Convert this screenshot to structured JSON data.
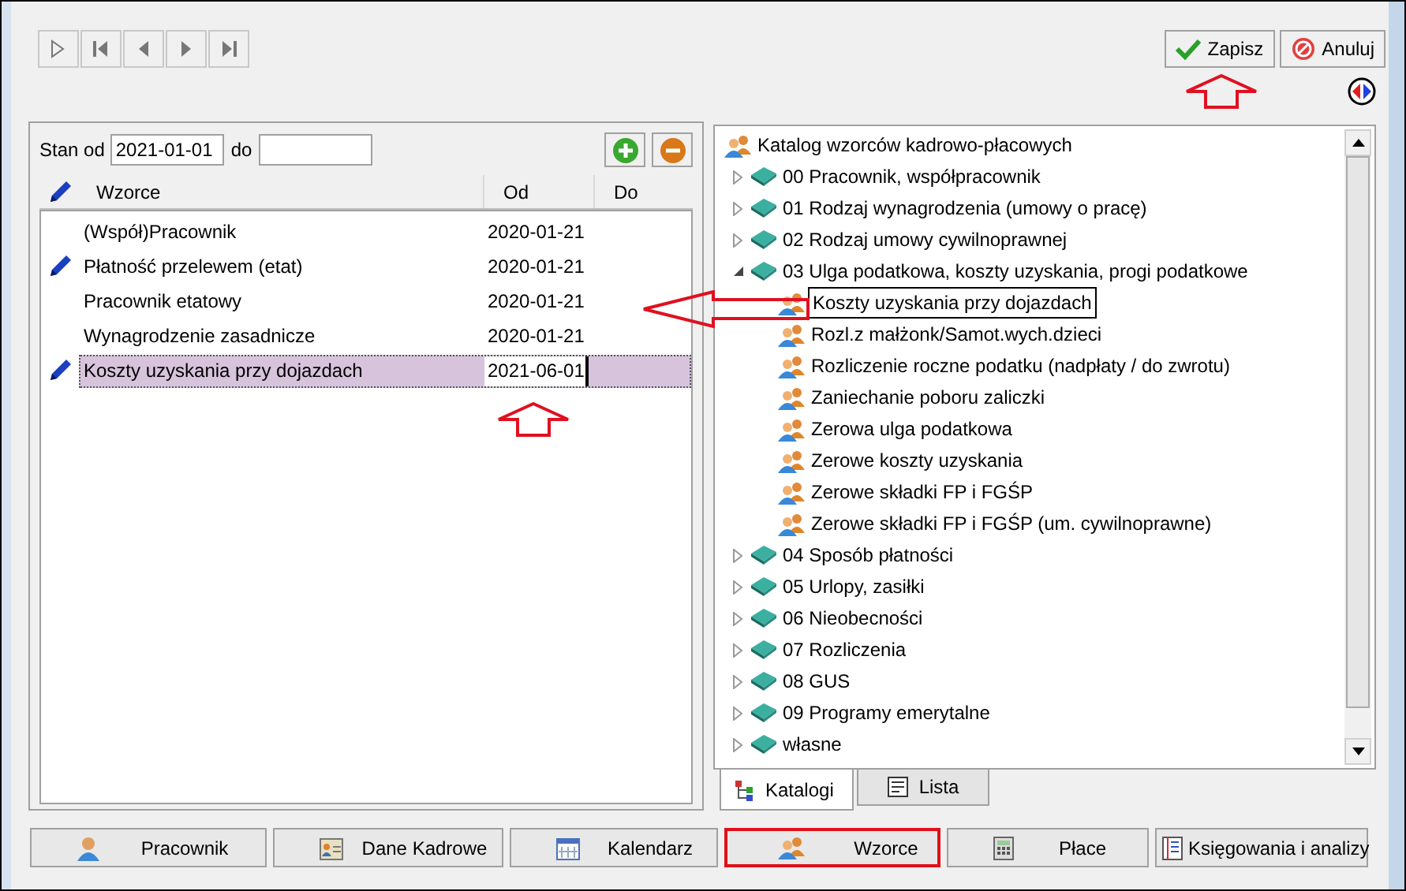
{
  "toolbar": {
    "actions": [
      {
        "label": "Zapisz",
        "kind": "save"
      },
      {
        "label": "Anuluj",
        "kind": "cancel"
      }
    ]
  },
  "filter": {
    "from_label": "Stan od",
    "from_value": "2021-01-01",
    "to_label": "do"
  },
  "table": {
    "columns": [
      "Wzorce",
      "Od",
      "Do"
    ],
    "rows": [
      {
        "name": "(Współ)Pracownik",
        "od": "2020-01-21",
        "edited": false,
        "selected": false
      },
      {
        "name": "Płatność przelewem (etat)",
        "od": "2020-01-21",
        "edited": true,
        "selected": false
      },
      {
        "name": "Pracownik etatowy",
        "od": "2020-01-21",
        "edited": false,
        "selected": false
      },
      {
        "name": "Wynagrodzenie zasadnicze",
        "od": "2020-01-21",
        "edited": false,
        "selected": false
      },
      {
        "name": "Koszty uzyskania przy dojazdach",
        "od": "2021-06-01",
        "edited": true,
        "selected": true
      }
    ]
  },
  "tree": {
    "label": "Katalog wzorców kadrowo-płacowych",
    "children": [
      {
        "label": "00 Pracownik, współpracownik",
        "expanded": false
      },
      {
        "label": "01 Rodzaj wynagrodzenia (umowy o pracę)",
        "expanded": false
      },
      {
        "label": "02 Rodzaj umowy cywilnoprawnej",
        "expanded": false
      },
      {
        "label": "03 Ulga podatkowa, koszty uzyskania, progi podatkowe",
        "expanded": true,
        "children": [
          {
            "label": "Koszty uzyskania przy dojazdach",
            "selected": true
          },
          {
            "label": "Rozl.z małżonk/Samot.wych.dzieci",
            "selected": false
          },
          {
            "label": "Rozliczenie roczne podatku (nadpłaty / do zwrotu)",
            "selected": false
          },
          {
            "label": "Zaniechanie poboru zaliczki",
            "selected": false
          },
          {
            "label": "Zerowa ulga podatkowa",
            "selected": false
          },
          {
            "label": "Zerowe koszty uzyskania",
            "selected": false
          },
          {
            "label": "Zerowe składki FP i FGŚP",
            "selected": false
          },
          {
            "label": "Zerowe składki FP i FGŚP (um. cywilnoprawne)",
            "selected": false
          }
        ]
      },
      {
        "label": "04 Sposób płatności",
        "expanded": false
      },
      {
        "label": "05 Urlopy, zasiłki",
        "expanded": false
      },
      {
        "label": "06 Nieobecności",
        "expanded": false
      },
      {
        "label": "07 Rozliczenia",
        "expanded": false
      },
      {
        "label": "08 GUS",
        "expanded": false
      },
      {
        "label": "09 Programy emerytalne",
        "expanded": false
      },
      {
        "label": "własne",
        "expanded": false
      }
    ]
  },
  "tree_tabs": [
    {
      "label": "Katalogi",
      "kind": "tree",
      "selected": true
    },
    {
      "label": "Lista",
      "kind": "list",
      "selected": false
    }
  ],
  "bottom_tabs": [
    {
      "label": "Pracownik",
      "kind": "person",
      "selected": false
    },
    {
      "label": "Dane Kadrowe",
      "kind": "card",
      "selected": false
    },
    {
      "label": "Kalendarz",
      "kind": "calendar",
      "selected": false
    },
    {
      "label": "Wzorce",
      "kind": "people",
      "selected": true
    },
    {
      "label": "Płace",
      "kind": "calculator",
      "selected": false
    },
    {
      "label": "Księgowania i analizy",
      "kind": "ledger",
      "selected": false
    }
  ]
}
